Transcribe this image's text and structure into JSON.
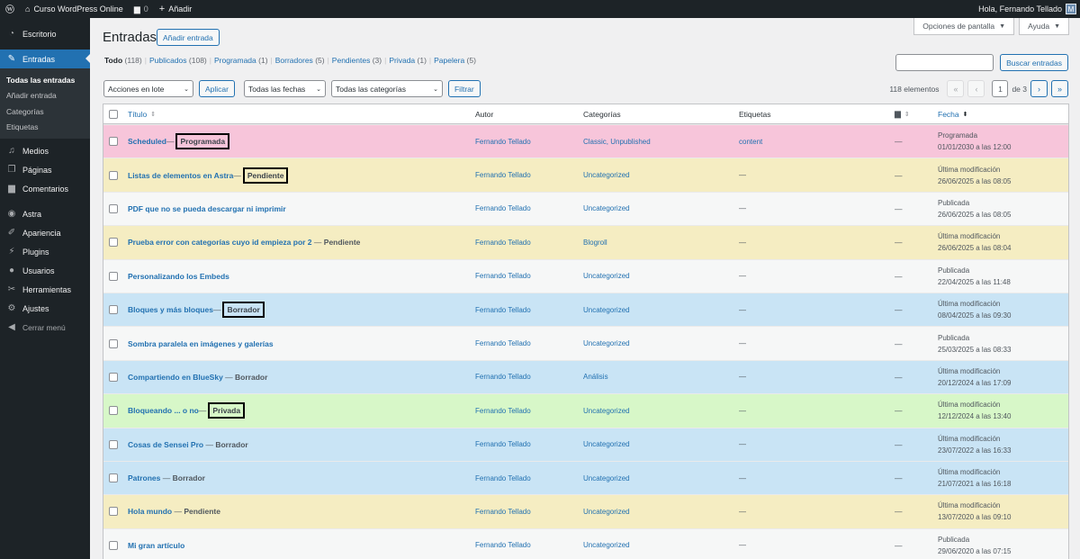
{
  "adminbar": {
    "site_name": "Curso WordPress Online",
    "comments_count": "0",
    "new_label": "Añadir",
    "greeting": "Hola, Fernando Tellado"
  },
  "sidebar": {
    "items": [
      {
        "label": "Escritorio",
        "icon": "dashboard-icon"
      },
      {
        "label": "Entradas",
        "icon": "pin-icon"
      },
      {
        "label": "Medios",
        "icon": "media-icon"
      },
      {
        "label": "Páginas",
        "icon": "pages-icon"
      },
      {
        "label": "Comentarios",
        "icon": "comments-icon"
      },
      {
        "label": "Astra",
        "icon": "astra-icon"
      },
      {
        "label": "Apariencia",
        "icon": "brush-icon"
      },
      {
        "label": "Plugins",
        "icon": "plugin-icon"
      },
      {
        "label": "Usuarios",
        "icon": "users-icon"
      },
      {
        "label": "Herramientas",
        "icon": "tools-icon"
      },
      {
        "label": "Ajustes",
        "icon": "settings-icon"
      },
      {
        "label": "Cerrar menú",
        "icon": "collapse-icon"
      }
    ],
    "submenu": [
      "Todas las entradas",
      "Añadir entrada",
      "Categorías",
      "Etiquetas"
    ]
  },
  "screen_meta": {
    "options": "Opciones de pantalla",
    "help": "Ayuda"
  },
  "page": {
    "title": "Entradas",
    "add_new": "Añadir entrada"
  },
  "filters": {
    "all": "Todo",
    "all_count": "(118)",
    "published": "Publicados",
    "published_count": "(108)",
    "scheduled": "Programada",
    "scheduled_count": "(1)",
    "drafts": "Borradores",
    "drafts_count": "(5)",
    "pending": "Pendientes",
    "pending_count": "(3)",
    "private": "Privada",
    "private_count": "(1)",
    "trash": "Papelera",
    "trash_count": "(5)"
  },
  "search": {
    "button": "Buscar entradas"
  },
  "tablenav": {
    "bulk_actions": "Acciones en lote",
    "apply": "Aplicar",
    "dates": "Todas las fechas",
    "categories": "Todas las categorías",
    "filter": "Filtrar"
  },
  "pagination": {
    "count": "118 elementos",
    "current": "1",
    "of": "de 3",
    "first": "«",
    "prev": "‹",
    "next": "›",
    "last": "»"
  },
  "table": {
    "headers": {
      "title": "Título",
      "author": "Autor",
      "categories": "Categorías",
      "tags": "Etiquetas",
      "date": "Fecha"
    },
    "rows": [
      {
        "title": "Scheduled",
        "sep": " —",
        "state": "Programada",
        "boxed": true,
        "author": "Fernando Tellado",
        "categories": "Classic, Unpublished",
        "tags": "content",
        "comments": "—",
        "date_status": "Programada",
        "date": "01/01/2030 a las 12:00",
        "color": "pink"
      },
      {
        "title": "Listas de elementos en Astra",
        "sep": " —",
        "state": "Pendiente",
        "boxed": true,
        "author": "Fernando Tellado",
        "categories": "Uncategorized",
        "tags": "—",
        "comments": "—",
        "date_status": "Última modificación",
        "date": "26/06/2025 a las 08:05",
        "color": "yellow"
      },
      {
        "title": "PDF que no se pueda descargar ni imprimir",
        "sep": "",
        "state": "",
        "boxed": false,
        "author": "Fernando Tellado",
        "categories": "Uncategorized",
        "tags": "—",
        "comments": "—",
        "date_status": "Publicada",
        "date": "26/06/2025 a las 08:05",
        "color": "white"
      },
      {
        "title": "Prueba error con categorías cuyo id empieza por 2",
        "sep": " — ",
        "state": "Pendiente",
        "boxed": false,
        "author": "Fernando Tellado",
        "categories": "Blogroll",
        "tags": "—",
        "comments": "—",
        "date_status": "Última modificación",
        "date": "26/06/2025 a las 08:04",
        "color": "yellow"
      },
      {
        "title": "Personalizando los Embeds",
        "sep": "",
        "state": "",
        "boxed": false,
        "author": "Fernando Tellado",
        "categories": "Uncategorized",
        "tags": "—",
        "comments": "—",
        "date_status": "Publicada",
        "date": "22/04/2025 a las 11:48",
        "color": "white"
      },
      {
        "title": "Bloques y más bloques",
        "sep": " —",
        "state": "Borrador",
        "boxed": true,
        "author": "Fernando Tellado",
        "categories": "Uncategorized",
        "tags": "—",
        "comments": "—",
        "date_status": "Última modificación",
        "date": "08/04/2025 a las 09:30",
        "color": "blue"
      },
      {
        "title": "Sombra paralela en imágenes y galerías",
        "sep": "",
        "state": "",
        "boxed": false,
        "author": "Fernando Tellado",
        "categories": "Uncategorized",
        "tags": "—",
        "comments": "—",
        "date_status": "Publicada",
        "date": "25/03/2025 a las 08:33",
        "color": "white"
      },
      {
        "title": "Compartiendo en BlueSky",
        "sep": " — ",
        "state": "Borrador",
        "boxed": false,
        "author": "Fernando Tellado",
        "categories": "Análisis",
        "tags": "—",
        "comments": "—",
        "date_status": "Última modificación",
        "date": "20/12/2024 a las 17:09",
        "color": "blue"
      },
      {
        "title": "Bloqueando ... o no",
        "sep": " —",
        "state": "Privada",
        "boxed": true,
        "author": "Fernando Tellado",
        "categories": "Uncategorized",
        "tags": "—",
        "comments": "—",
        "date_status": "Última modificación",
        "date": "12/12/2024 a las 13:40",
        "color": "green"
      },
      {
        "title": "Cosas de Sensei Pro",
        "sep": " — ",
        "state": "Borrador",
        "boxed": false,
        "author": "Fernando Tellado",
        "categories": "Uncategorized",
        "tags": "—",
        "comments": "—",
        "date_status": "Última modificación",
        "date": "23/07/2022 a las 16:33",
        "color": "blue"
      },
      {
        "title": "Patrones",
        "sep": " — ",
        "state": "Borrador",
        "boxed": false,
        "author": "Fernando Tellado",
        "categories": "Uncategorized",
        "tags": "—",
        "comments": "—",
        "date_status": "Última modificación",
        "date": "21/07/2021 a las 16:18",
        "color": "blue"
      },
      {
        "title": "Hola mundo",
        "sep": " — ",
        "state": "Pendiente",
        "boxed": false,
        "author": "Fernando Tellado",
        "categories": "Uncategorized",
        "tags": "—",
        "comments": "—",
        "date_status": "Última modificación",
        "date": "13/07/2020 a las 09:10",
        "color": "yellow"
      },
      {
        "title": "Mi gran artículo",
        "sep": "",
        "state": "",
        "boxed": false,
        "author": "Fernando Tellado",
        "categories": "Uncategorized",
        "tags": "—",
        "comments": "—",
        "date_status": "Publicada",
        "date": "29/06/2020 a las 07:15",
        "color": "white"
      }
    ]
  }
}
